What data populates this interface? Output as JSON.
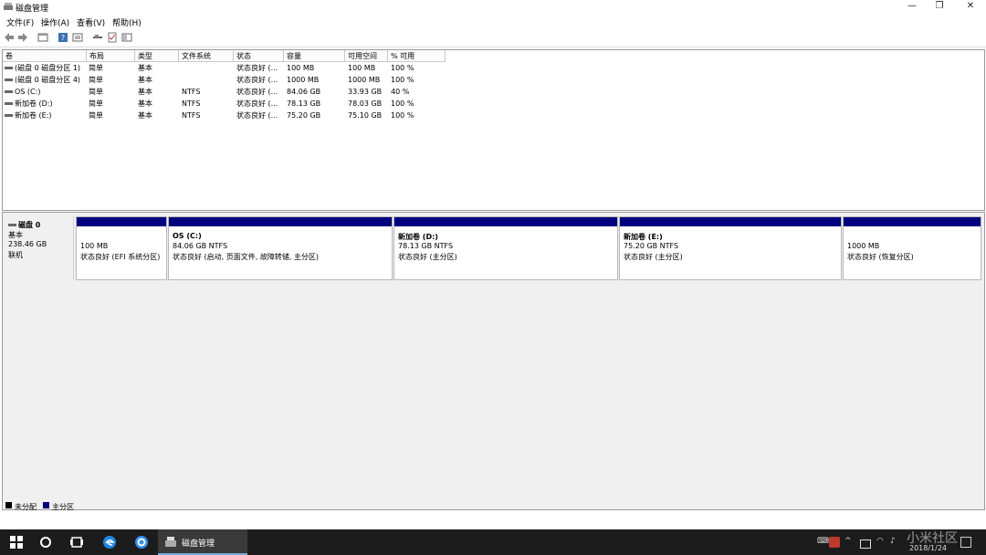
{
  "window": {
    "title": "磁盘管理",
    "controls": {
      "minimize": "—",
      "restore": "❐",
      "close": "✕"
    }
  },
  "menu": [
    "文件(F)",
    "操作(A)",
    "查看(V)",
    "帮助(H)"
  ],
  "columns": [
    "卷",
    "布局",
    "类型",
    "文件系统",
    "状态",
    "容量",
    "可用空间",
    "% 可用"
  ],
  "volumes": [
    {
      "name": "(磁盘 0 磁盘分区 1)",
      "layout": "简单",
      "type": "基本",
      "fs": "",
      "status": "状态良好 (...",
      "capacity": "100 MB",
      "free": "100 MB",
      "pct": "100 %"
    },
    {
      "name": "(磁盘 0 磁盘分区 4)",
      "layout": "简单",
      "type": "基本",
      "fs": "",
      "status": "状态良好 (...",
      "capacity": "1000 MB",
      "free": "1000 MB",
      "pct": "100 %"
    },
    {
      "name": "OS (C:)",
      "layout": "简单",
      "type": "基本",
      "fs": "NTFS",
      "status": "状态良好 (...",
      "capacity": "84.06 GB",
      "free": "33.93 GB",
      "pct": "40 %"
    },
    {
      "name": "新加卷 (D:)",
      "layout": "简单",
      "type": "基本",
      "fs": "NTFS",
      "status": "状态良好 (...",
      "capacity": "78.13 GB",
      "free": "78.03 GB",
      "pct": "100 %"
    },
    {
      "name": "新加卷 (E:)",
      "layout": "简单",
      "type": "基本",
      "fs": "NTFS",
      "status": "状态良好 (...",
      "capacity": "75.20 GB",
      "free": "75.10 GB",
      "pct": "100 %"
    }
  ],
  "disk": {
    "name": "磁盘 0",
    "type": "基本",
    "size": "238.46 GB",
    "state": "联机",
    "partitions": [
      {
        "title": "",
        "size": "100 MB",
        "status": "状态良好 (EFI 系统分区)"
      },
      {
        "title": "OS  (C:)",
        "size": "84.06 GB NTFS",
        "status": "状态良好 (启动, 页面文件, 故障转储, 主分区)"
      },
      {
        "title": "新加卷  (D:)",
        "size": "78.13 GB NTFS",
        "status": "状态良好 (主分区)"
      },
      {
        "title": "新加卷  (E:)",
        "size": "75.20 GB NTFS",
        "status": "状态良好 (主分区)"
      },
      {
        "title": "",
        "size": "1000 MB",
        "status": "状态良好 (恢复分区)"
      }
    ]
  },
  "legend": [
    {
      "label": "未分配",
      "color": "#000000"
    },
    {
      "label": "主分区",
      "color": "#00007f"
    }
  ],
  "taskbar": {
    "active_app": "磁盘管理",
    "date": "2018/1/24",
    "watermark": "小米社区"
  },
  "colors": {
    "primary_partition": "#00007f",
    "taskbar": "#1c1c1c"
  }
}
